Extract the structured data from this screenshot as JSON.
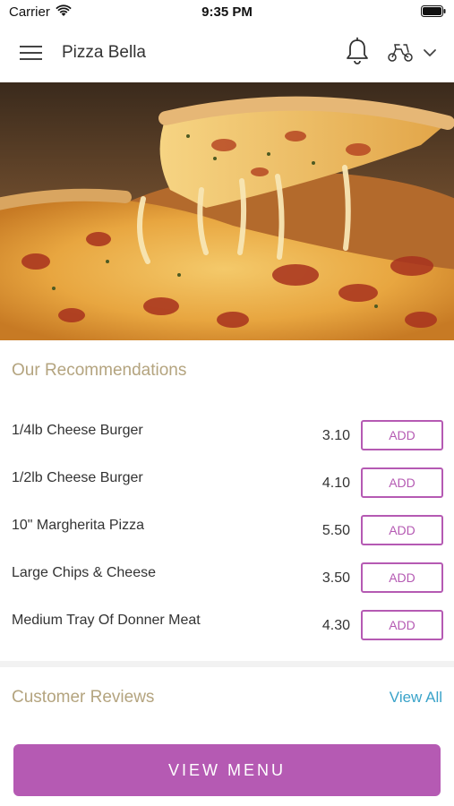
{
  "status_bar": {
    "carrier": "Carrier",
    "time": "9:35 PM"
  },
  "header": {
    "title": "Pizza Bella",
    "icons": [
      "menu-icon",
      "bell-icon",
      "scooter-icon",
      "chevron-down-icon"
    ]
  },
  "hero": {
    "image": "pizza-slice-cheese-pull"
  },
  "recommendations": {
    "title": "Our Recommendations",
    "items": [
      {
        "name": "1/4lb Cheese Burger",
        "price": "3.10",
        "action": "ADD"
      },
      {
        "name": "1/2lb Cheese Burger",
        "price": "4.10",
        "action": "ADD"
      },
      {
        "name": "10\" Margherita Pizza",
        "price": "5.50",
        "action": "ADD"
      },
      {
        "name": "Large Chips & Cheese",
        "price": "3.50",
        "action": "ADD"
      },
      {
        "name": "Medium Tray Of Donner Meat",
        "price": "4.30",
        "action": "ADD"
      }
    ]
  },
  "reviews": {
    "title": "Customer Reviews",
    "view_all": "View All"
  },
  "footer": {
    "view_menu": "VIEW MENU"
  },
  "colors": {
    "accent": "#b55ab3",
    "section_title": "#b4a47f",
    "link": "#3aa3c9"
  }
}
